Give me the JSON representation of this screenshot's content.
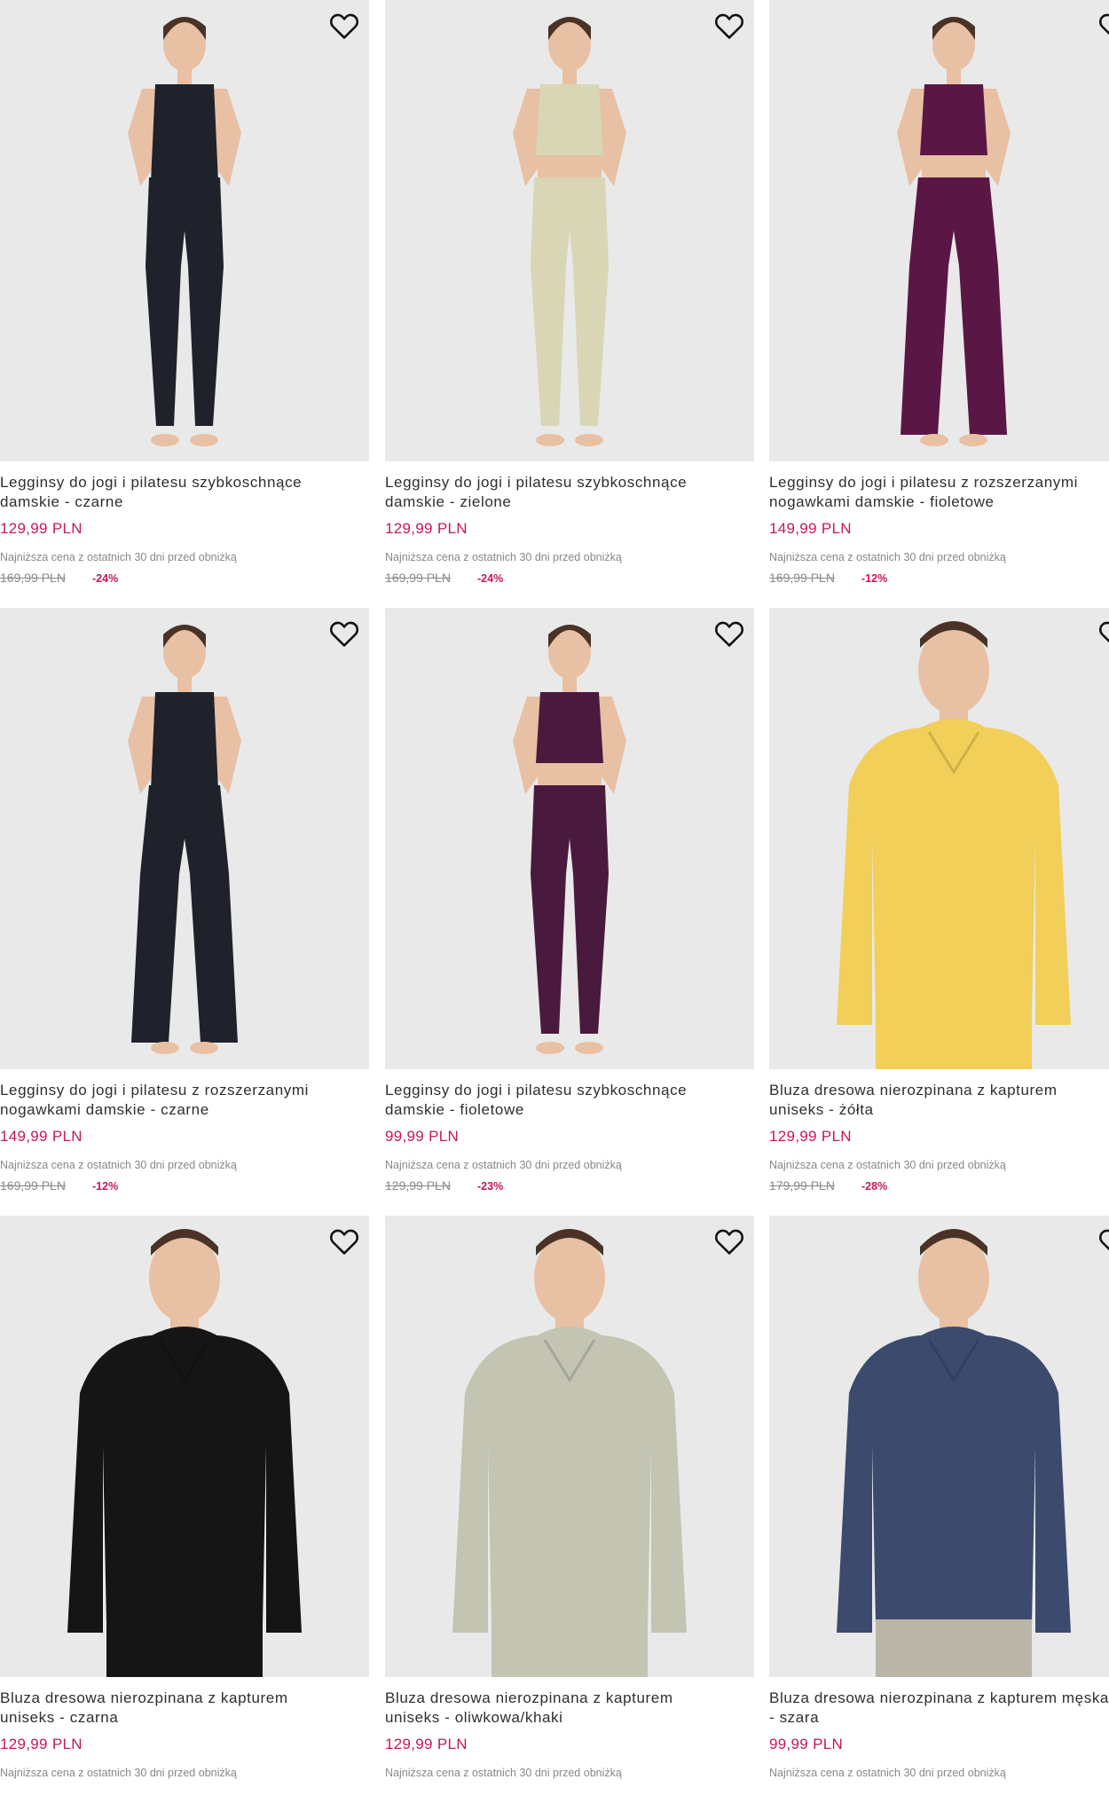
{
  "icons": {
    "favorite": "heart-outline-icon"
  },
  "colors": {
    "price": "#c2185b",
    "background_image": "#e9e9e9",
    "text": "#2e2e2e"
  },
  "products": [
    {
      "title": "Legginsy do jogi i pilatesu szybkoschnące\ndamskie - czarne",
      "price": "129,99 PLN",
      "lowest_label": "Najniższa cena z ostatnich 30 dni przed obniżką",
      "old_price": "169,99 PLN",
      "discount": "-24%",
      "garment": "leggings-top",
      "top_color": "#1f222a",
      "bottom_color": "#1f222a"
    },
    {
      "title": "Legginsy do jogi i pilatesu szybkoschnące\ndamskie - zielone",
      "price": "129,99 PLN",
      "lowest_label": "Najniższa cena z ostatnich 30 dni przed obniżką",
      "old_price": "169,99 PLN",
      "discount": "-24%",
      "garment": "leggings-bra",
      "top_color": "#d9d6b6",
      "bottom_color": "#d9d6b6"
    },
    {
      "title": "Legginsy do jogi i pilatesu z rozszerzanymi\nnogawkami damskie - fioletowe",
      "price": "149,99 PLN",
      "lowest_label": "Najniższa cena z ostatnich 30 dni przed obniżką",
      "old_price": "169,99 PLN",
      "discount": "-12%",
      "garment": "flare-bra",
      "top_color": "#5a1746",
      "bottom_color": "#5a1746"
    },
    {
      "title": "Legginsy do jogi i pilatesu z rozszerzanymi\nnogawkami damskie - czarne",
      "price": "149,99 PLN",
      "lowest_label": "Najniższa cena z ostatnich 30 dni przed obniżką",
      "old_price": "169,99 PLN",
      "discount": "-12%",
      "garment": "flare-top",
      "top_color": "#1f222a",
      "bottom_color": "#1f222a"
    },
    {
      "title": "Legginsy do jogi i pilatesu szybkoschnące\ndamskie - fioletowe",
      "price": "99,99 PLN",
      "lowest_label": "Najniższa cena z ostatnich 30 dni przed obniżką",
      "old_price": "129,99 PLN",
      "discount": "-23%",
      "garment": "leggings-bra",
      "top_color": "#4a1a3e",
      "bottom_color": "#4a1a3e"
    },
    {
      "title": "Bluza dresowa nierozpinana z kapturem\nuniseks - żółta",
      "price": "129,99 PLN",
      "lowest_label": "Najniższa cena z ostatnich 30 dni przed obniżką",
      "old_price": "179,99 PLN",
      "discount": "-28%",
      "garment": "hoodie",
      "top_color": "#f2cf58",
      "bottom_color": "#f2cf58"
    },
    {
      "title": "Bluza dresowa nierozpinana z kapturem\nuniseks - czarna",
      "price": "129,99 PLN",
      "lowest_label": "Najniższa cena z ostatnich 30 dni przed obniżką",
      "old_price": "",
      "discount": "",
      "garment": "hoodie",
      "top_color": "#151515",
      "bottom_color": "#151515"
    },
    {
      "title": "Bluza dresowa nierozpinana z kapturem\nuniseks - oliwkowa/khaki",
      "price": "129,99 PLN",
      "lowest_label": "Najniższa cena z ostatnich 30 dni przed obniżką",
      "old_price": "",
      "discount": "",
      "garment": "hoodie",
      "top_color": "#c3c4b1",
      "bottom_color": "#c3c4b1"
    },
    {
      "title": "Bluza dresowa nierozpinana z kapturem męska\n- szara",
      "price": "99,99 PLN",
      "lowest_label": "Najniższa cena z ostatnich 30 dni przed obniżką",
      "old_price": "",
      "discount": "",
      "garment": "hoodie",
      "top_color": "#3c4a6e",
      "bottom_color": "#b9b6a8"
    }
  ]
}
